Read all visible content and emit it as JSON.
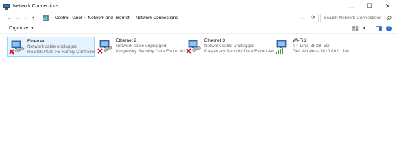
{
  "window": {
    "title": "Network Connections",
    "minimize_label": "—",
    "maximize_label": "☐",
    "close_label": "✕"
  },
  "nav": {
    "back_glyph": "←",
    "forward_glyph": "→",
    "recent_glyph": "⌄",
    "up_glyph": "↑"
  },
  "breadcrumb": {
    "items": [
      "Control Panel",
      "Network and Internet",
      "Network Connections"
    ],
    "separator": "›"
  },
  "search": {
    "placeholder": "Search Network Connections"
  },
  "toolbar": {
    "organize_label": "Organize",
    "organize_caret": "▼"
  },
  "connections": [
    {
      "name": "Ethernet",
      "status": "Network cable unplugged",
      "adapter": "Realtek PCIe FE Family Controller",
      "type": "ethernet",
      "state": "disconnected"
    },
    {
      "name": "Ethernet 2",
      "status": "Network cable unplugged",
      "adapter": "Kaspersky Security Data Escort Ad...",
      "type": "ethernet",
      "state": "disconnected"
    },
    {
      "name": "Ethernet 3",
      "status": "Network cable unplugged",
      "adapter": "Kaspersky Security Data Escort Ad...",
      "type": "ethernet",
      "state": "disconnected"
    },
    {
      "name": "Wi-Fi 2",
      "status": "TP-Link_3F2B_5G",
      "adapter": "Dell Wireless 1810 802.11ac",
      "type": "wifi",
      "state": "connected"
    }
  ],
  "colors": {
    "selection_bg": "#e5f3ff",
    "selection_border": "#99d1ff",
    "error_red": "#d0021b",
    "signal_green": "#3aa63a",
    "monitor_blue": "#3b78c4"
  }
}
